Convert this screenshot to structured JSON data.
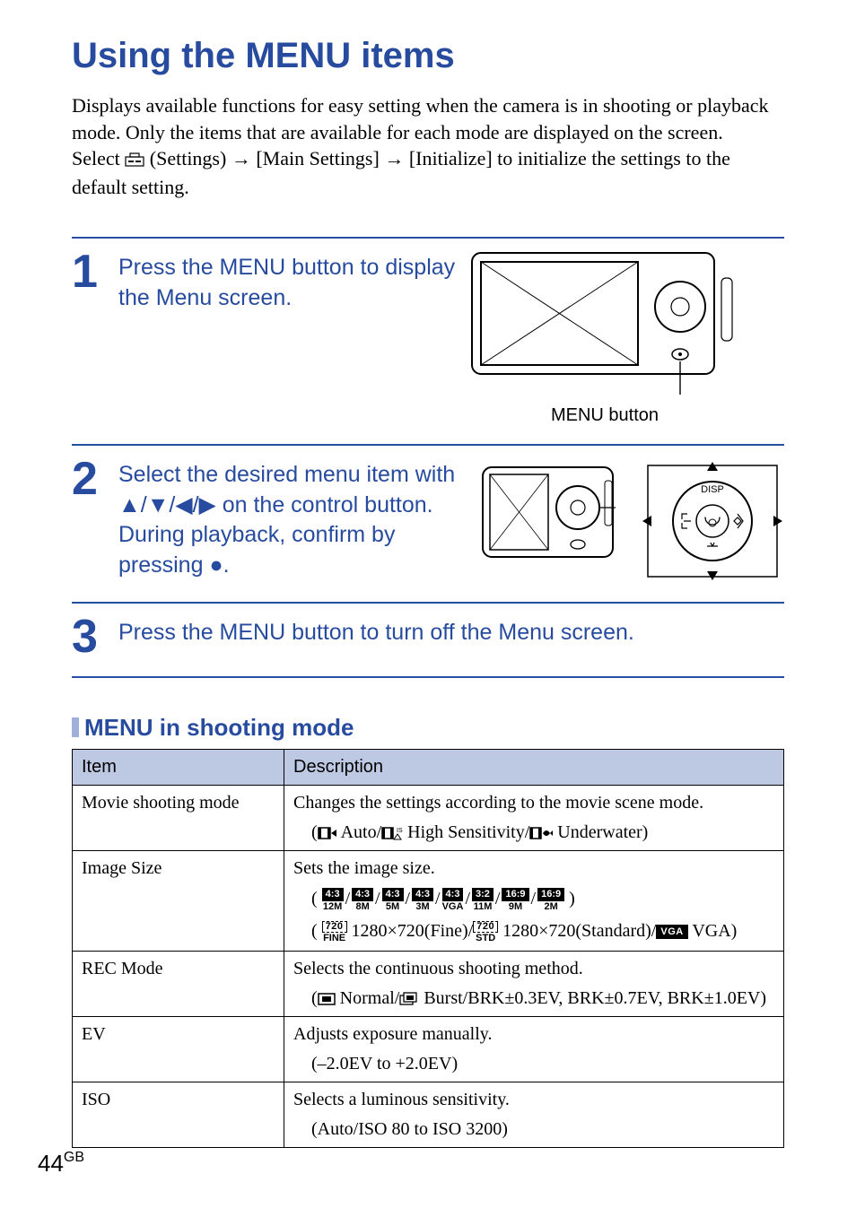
{
  "title": "Using the MENU items",
  "intro": {
    "line1": "Displays available functions for easy setting when the camera is in shooting or playback mode. Only the items that are available for each mode are displayed on the screen.",
    "line2a": "Select ",
    "settings": " (Settings) ",
    "main_settings": " [Main Settings] ",
    "initialize": " [Initialize] to initialize the settings to the default setting."
  },
  "steps": {
    "s1": "Press the MENU button to display the Menu screen.",
    "s2a": "Select the desired menu item with ",
    "s2b": " on the control button. During playback, confirm by pressing ",
    "s2c": ".",
    "s3": "Press the MENU button to turn off the Menu screen.",
    "caption1": "MENU button"
  },
  "subhead": "MENU in shooting mode",
  "table": {
    "h_item": "Item",
    "h_desc": "Description",
    "rows": [
      {
        "item": "Movie shooting mode",
        "desc": "Changes the settings according to the movie scene mode.",
        "sub": "Auto/",
        "sub2": "High Sensitivity/",
        "sub3": "Underwater"
      },
      {
        "item": "Image Size",
        "desc": "Sets the image size.",
        "ratios": [
          {
            "t": "4:3",
            "b": "12M"
          },
          {
            "t": "4:3",
            "b": "8M"
          },
          {
            "t": "4:3",
            "b": "5M"
          },
          {
            "t": "4:3",
            "b": "3M"
          },
          {
            "t": "4:3",
            "b": "VGA"
          },
          {
            "t": "3:2",
            "b": "11M"
          },
          {
            "t": "16:9",
            "b": "9M"
          },
          {
            "t": "16:9",
            "b": "2M"
          }
        ],
        "mov": [
          {
            "t": "720",
            "b": "FINE",
            "label": "1280×720(Fine)/"
          },
          {
            "t": "720",
            "b": "STD",
            "label": "1280×720(Standard)/"
          }
        ],
        "vga": "VGA",
        "vga_label": " VGA"
      },
      {
        "item": "REC Mode",
        "desc": "Selects the continuous shooting method.",
        "sub_normal": "Normal/",
        "sub_burst": "Burst/BRK±0.3EV, BRK±0.7EV, BRK±1.0EV"
      },
      {
        "item": "EV",
        "desc": "Adjusts exposure manually.",
        "sub": "(–2.0EV to +2.0EV)"
      },
      {
        "item": "ISO",
        "desc": "Selects a luminous sensitivity.",
        "sub": "(Auto/ISO 80 to ISO 3200)"
      }
    ]
  },
  "page": {
    "num": "44",
    "suffix": "GB"
  }
}
